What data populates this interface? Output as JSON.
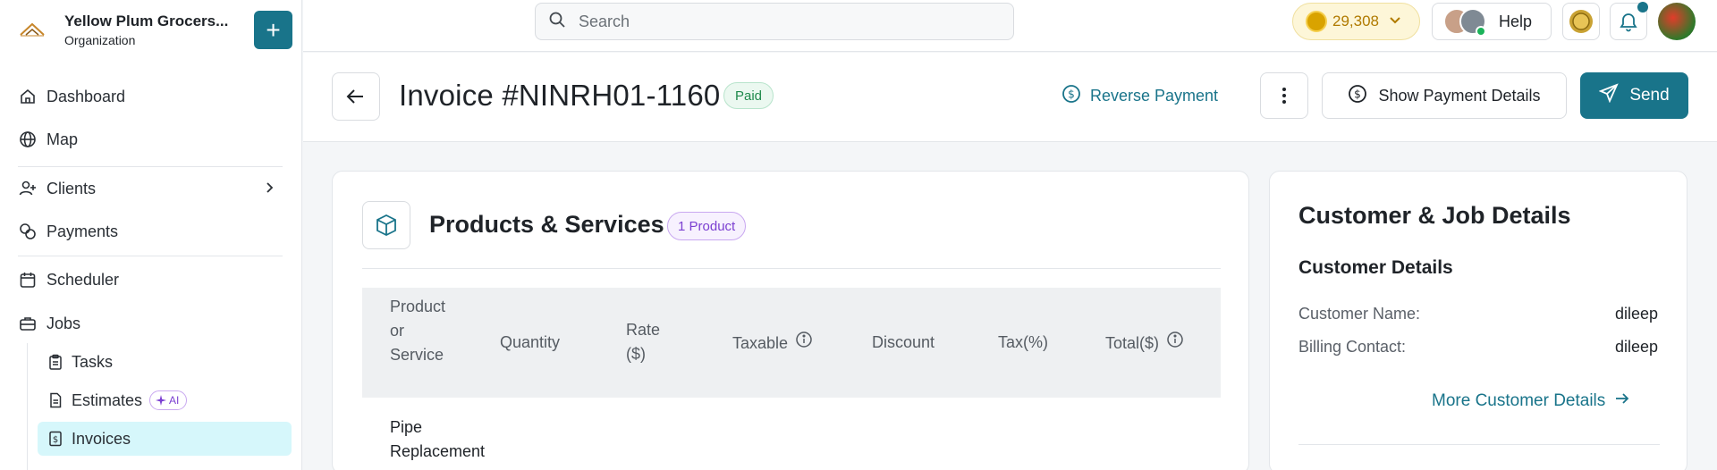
{
  "org": {
    "name": "Yellow Plum Grocers...",
    "subtitle": "Organization",
    "add_label": "+"
  },
  "nav": {
    "items": [
      {
        "label": "Dashboard",
        "icon": "home-icon"
      },
      {
        "label": "Map",
        "icon": "globe-icon"
      },
      {
        "label": "Clients",
        "icon": "user-plus-icon"
      },
      {
        "label": "Payments",
        "icon": "coins-icon"
      },
      {
        "label": "Scheduler",
        "icon": "calendar-icon"
      },
      {
        "label": "Jobs",
        "icon": "briefcase-icon"
      }
    ],
    "sub_items": [
      {
        "label": "Tasks",
        "icon": "clipboard-icon"
      },
      {
        "label": "Estimates",
        "icon": "document-icon",
        "badge": "AI"
      },
      {
        "label": "Invoices",
        "icon": "dollar-receipt-icon",
        "active": true
      }
    ]
  },
  "topbar": {
    "search_placeholder": "Search",
    "coins": "29,308",
    "help_label": "Help"
  },
  "header": {
    "title": "Invoice #NINRH01-1160",
    "status": "Paid",
    "reverse_label": "Reverse Payment",
    "show_payment_label": "Show Payment Details",
    "send_label": "Send"
  },
  "products": {
    "title": "Products & Services",
    "badge": "1 Product",
    "columns": [
      {
        "line1": "Product",
        "line2": "or",
        "line3": "Service"
      },
      {
        "line1": "Quantity"
      },
      {
        "line1": "Rate",
        "line2": "($)"
      },
      {
        "line1": "Taxable"
      },
      {
        "line1": "Discount"
      },
      {
        "line1": "Tax(%)"
      },
      {
        "line1": "Total($)"
      }
    ],
    "rows": [
      {
        "name_line1": "Pipe",
        "name_line2": "Replacement"
      }
    ]
  },
  "details": {
    "title": "Customer & Job Details",
    "subtitle": "Customer Details",
    "customer_name_label": "Customer Name:",
    "customer_name_value": "dileep",
    "billing_contact_label": "Billing Contact:",
    "billing_contact_value": "dileep",
    "more_label": "More Customer Details"
  },
  "colors": {
    "primary": "#19748a",
    "paid_green": "#1f8a4c",
    "ai_purple": "#7b3fd1",
    "active_bg": "#d6f7fb"
  }
}
